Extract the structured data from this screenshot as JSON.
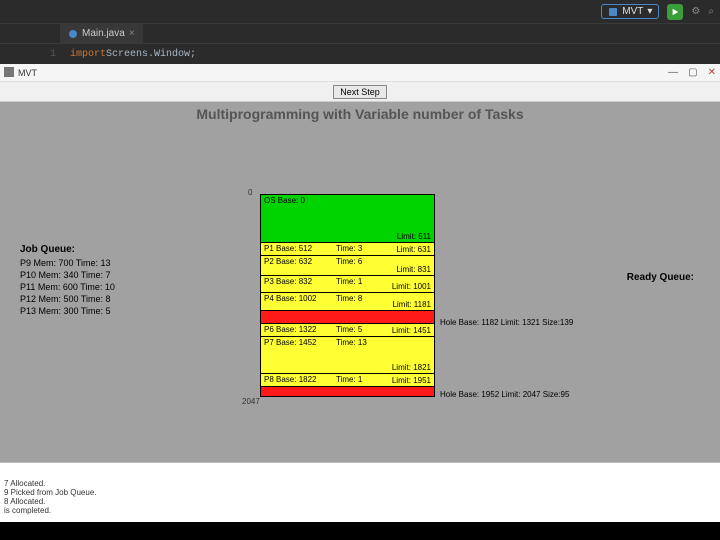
{
  "ide": {
    "run_config": "MVT",
    "tab": {
      "filename": "Main.java"
    },
    "code": {
      "line_no": "1",
      "keyword": "import",
      "rest": " Screens.Window;"
    }
  },
  "window": {
    "title": "MVT",
    "next_button": "Next Step",
    "heading": "Multiprogramming with Variable number of Tasks"
  },
  "job_queue": {
    "title": "Job Queue:",
    "items": [
      "P9 Mem: 700 Time: 13",
      "P10 Mem: 340 Time: 7",
      "P11 Mem: 600 Time: 10",
      "P12 Mem: 500 Time: 8",
      "P13 Mem: 300 Time: 5"
    ]
  },
  "ready_queue": {
    "title": "Ready Queue:"
  },
  "memory": {
    "start_label": "0",
    "end_label": "2047",
    "segments": [
      {
        "color": "green",
        "h": 48,
        "base": "OS Base: 0",
        "time": "",
        "limit": "Limit: 511"
      },
      {
        "color": "yellow",
        "h": 13,
        "base": "P1 Base: 512",
        "time": "Time: 3",
        "limit": "Limit: 631"
      },
      {
        "color": "yellow",
        "h": 20,
        "base": "P2 Base: 632",
        "time": "Time: 6",
        "limit": "Limit: 831"
      },
      {
        "color": "yellow",
        "h": 17,
        "base": "P3 Base: 832",
        "time": "Time: 1",
        "limit": "Limit: 1001"
      },
      {
        "color": "yellow",
        "h": 18,
        "base": "P4 Base: 1002",
        "time": "Time: 8",
        "limit": "Limit: 1181"
      },
      {
        "color": "red",
        "h": 13,
        "base": "",
        "time": "",
        "limit": "",
        "note": "Hole Base: 1182 Limit: 1321 Size:139"
      },
      {
        "color": "yellow",
        "h": 13,
        "base": "P6 Base: 1322",
        "time": "Time: 5",
        "limit": "Limit: 1451"
      },
      {
        "color": "yellow",
        "h": 37,
        "base": "P7 Base: 1452",
        "time": "Time: 13",
        "limit": "Limit: 1821"
      },
      {
        "color": "yellow",
        "h": 13,
        "base": "P8 Base: 1822",
        "time": "Time: 1",
        "limit": "Limit: 1951"
      },
      {
        "color": "red",
        "h": 9,
        "base": "",
        "time": "",
        "limit": "",
        "note": "Hole Base: 1952 Limit: 2047 Size:95"
      }
    ]
  },
  "console": {
    "lines": [
      "7 Allocated.",
      "9 Picked from Job Queue.",
      "8 Allocated.",
      "is completed."
    ]
  }
}
